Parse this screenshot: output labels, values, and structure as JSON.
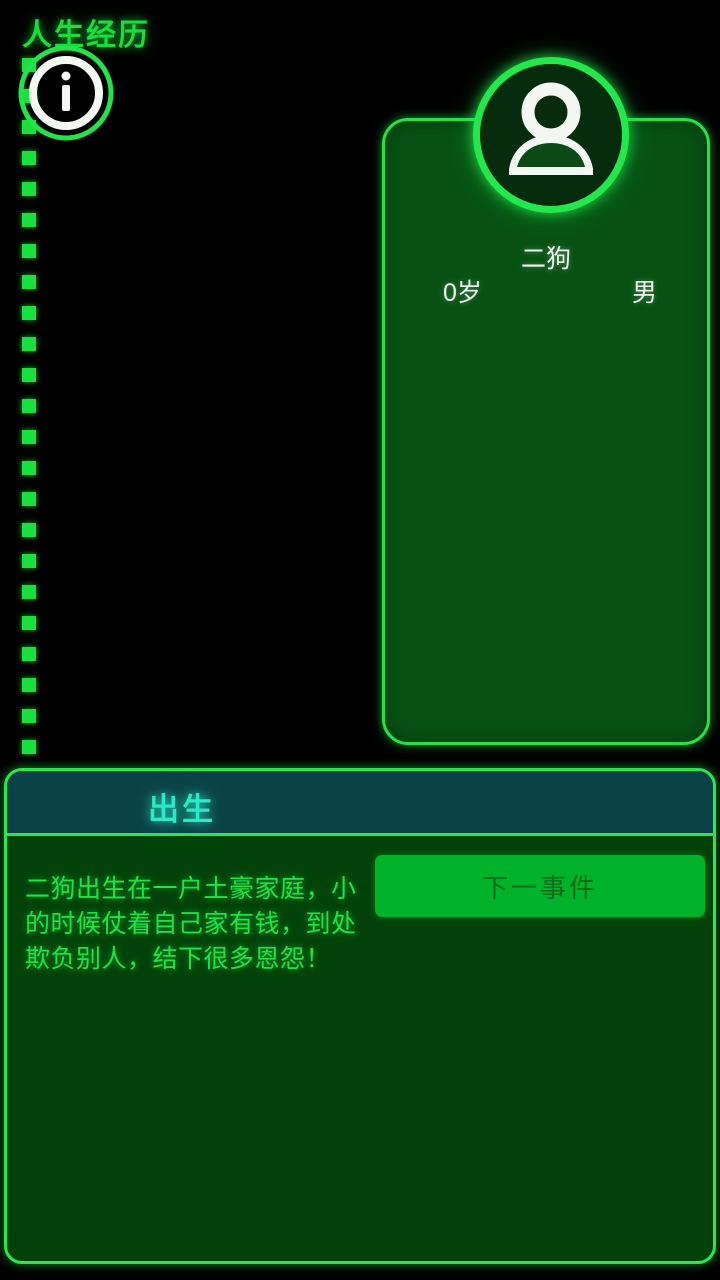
{
  "screen": {
    "title": "人生经历",
    "background_color": "#000000",
    "accent_color": "#19dd3c",
    "cyan_color": "#2ae9c6"
  },
  "timeline": {
    "dash_count": 23,
    "dash_color": "#19e03f"
  },
  "character": {
    "avatar_icon": "person-avatar-icon",
    "name": "二狗",
    "age": "0岁",
    "gender": "男"
  },
  "event": {
    "icon": "info-circle-icon",
    "title": "出生",
    "description": "二狗出生在一户土豪家庭，小的时候仗着自己家有钱，到处欺负别人，结下很多恩怨！",
    "next_button_label": "下一事件"
  }
}
